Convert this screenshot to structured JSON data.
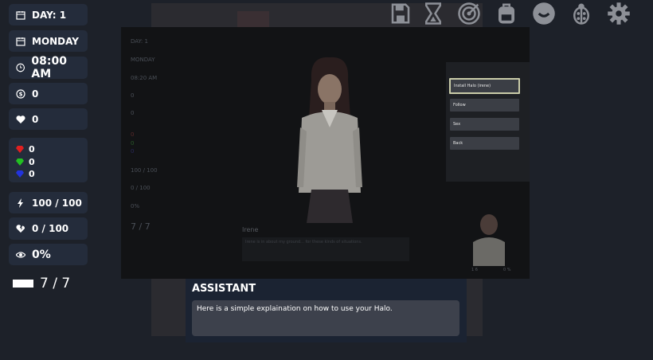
{
  "sidebar": {
    "day": "DAY: 1",
    "weekday": "MONDAY",
    "time": "08:00 AM",
    "money": "0",
    "hearts": "0",
    "gems": {
      "red": "0",
      "green": "0",
      "blue": "0"
    },
    "energy": "100 / 100",
    "fatigue": "0 / 100",
    "vision": "0%",
    "counter": "7 / 7"
  },
  "topbar_icons": [
    "save-icon",
    "hourglass-icon",
    "target-icon",
    "backpack-icon",
    "smile-icon",
    "ladybug-icon",
    "gear-icon"
  ],
  "overlay": {
    "sidebar": {
      "day": "DAY: 1",
      "weekday": "MONDAY",
      "time": "08:20 AM",
      "money": "0",
      "hearts": "0",
      "gems": {
        "red": "0",
        "green": "0",
        "blue": "0"
      },
      "energy": "100 / 100",
      "fatigue": "0 / 100",
      "vision": "0%",
      "counter": "7 / 7"
    },
    "character_name": "Irene",
    "dialogue_text": "Irene is in about my ground... for these kinds of situations.",
    "menu": [
      "Install Halo (irene)",
      "Follow",
      "Sex",
      "Back"
    ],
    "mini_labels": [
      "1 6",
      "0 %"
    ]
  },
  "assistant": {
    "title": "ASSISTANT",
    "message": "Here is a simple explaination on how to use your Halo."
  },
  "colors": {
    "panel": "#242c3b",
    "background": "#1d2129",
    "red_gem": "#e02020",
    "green_gem": "#22c022",
    "blue_gem": "#2233dd"
  }
}
